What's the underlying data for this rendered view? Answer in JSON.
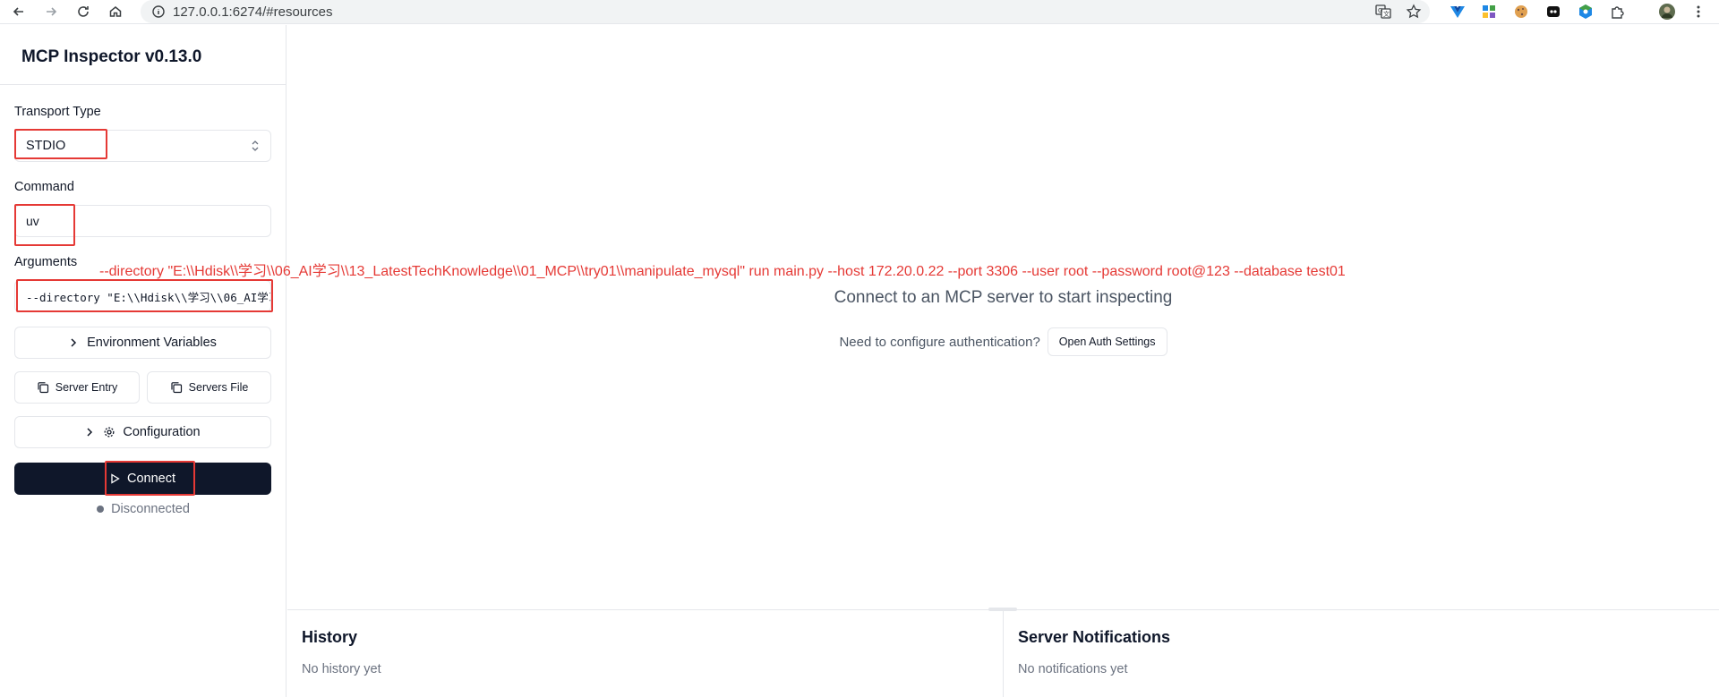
{
  "browser": {
    "url": "127.0.0.1:6274/#resources",
    "nav_icons": [
      "back-arrow-icon",
      "forward-arrow-icon",
      "reload-icon",
      "home-icon"
    ],
    "toolbar_icons": [
      "translate-icon",
      "bookmark-star-icon"
    ],
    "extension_icons": [
      "vue-devtools-icon",
      "apps-grid-icon",
      "cookie-icon",
      "ghost-icon",
      "colorful-hexagon-icon",
      "puzzle-extensions-icon",
      "profile-avatar-icon",
      "more-vertical-icon"
    ]
  },
  "sidebar": {
    "title": "MCP Inspector v0.13.0",
    "transport_label": "Transport Type",
    "transport_value": "STDIO",
    "command_label": "Command",
    "command_value": "uv",
    "arguments_label": "Arguments",
    "arguments_value": "--directory \"E:\\\\Hdisk\\\\学习\\\\06_AI学习\\\\13_LatestTechKnowledge\\\\01_MCP\\\\try01\\\\manipulate_mysql\" run main.py --host 172.20.0.22 --port 3306 --user root --password root@123 --database test01",
    "env_button": "Environment Variables",
    "server_entry_button": "Server Entry",
    "servers_file_button": "Servers File",
    "configuration_button": "Configuration",
    "connect_button": "Connect",
    "status": "Disconnected"
  },
  "main": {
    "annotation": "--directory \"E:\\\\Hdisk\\\\学习\\\\06_AI学习\\\\13_LatestTechKnowledge\\\\01_MCP\\\\try01\\\\manipulate_mysql\" run main.py --host 172.20.0.22 --port 3306 --user root --password root@123 --database test01",
    "empty_title": "Connect to an MCP server to start inspecting",
    "auth_prompt": "Need to configure authentication?",
    "auth_button": "Open Auth Settings"
  },
  "history": {
    "title": "History",
    "empty": "No history yet"
  },
  "notifications": {
    "title": "Server Notifications",
    "empty": "No notifications yet"
  },
  "colors": {
    "annotation_red": "#e53935",
    "connect_bg": "#0f172a",
    "border": "#e5e7eb"
  }
}
